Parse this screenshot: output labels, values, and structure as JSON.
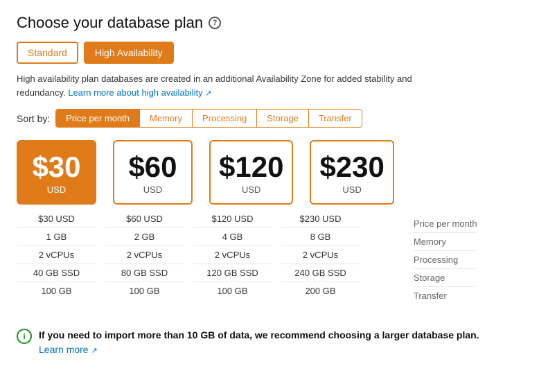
{
  "page": {
    "title": "Choose your database plan",
    "help_icon": "?",
    "description": "High availability plan databases are created in an additional Availability Zone for added stability and redundancy.",
    "learn_more_link": "Learn more about high availability",
    "sort_label": "Sort by:"
  },
  "plan_toggle": {
    "standard_label": "Standard",
    "high_availability_label": "High Availability"
  },
  "sort_tabs": [
    {
      "id": "price",
      "label": "Price per month",
      "active": true
    },
    {
      "id": "memory",
      "label": "Memory",
      "active": false
    },
    {
      "id": "processing",
      "label": "Processing",
      "active": false
    },
    {
      "id": "storage",
      "label": "Storage",
      "active": false
    },
    {
      "id": "transfer",
      "label": "Transfer",
      "active": false
    }
  ],
  "plans": [
    {
      "price": "$30",
      "currency": "USD",
      "selected": true,
      "details": {
        "price_per_month": "$30 USD",
        "memory": "1 GB",
        "processing": "2 vCPUs",
        "storage": "40 GB SSD",
        "transfer": "100 GB"
      }
    },
    {
      "price": "$60",
      "currency": "USD",
      "selected": false,
      "details": {
        "price_per_month": "$60 USD",
        "memory": "2 GB",
        "processing": "2 vCPUs",
        "storage": "80 GB SSD",
        "transfer": "100 GB"
      }
    },
    {
      "price": "$120",
      "currency": "USD",
      "selected": false,
      "details": {
        "price_per_month": "$120 USD",
        "memory": "4 GB",
        "processing": "2 vCPUs",
        "storage": "120 GB SSD",
        "transfer": "100 GB"
      }
    },
    {
      "price": "$230",
      "currency": "USD",
      "selected": false,
      "details": {
        "price_per_month": "$230 USD",
        "memory": "8 GB",
        "processing": "2 vCPUs",
        "storage": "240 GB SSD",
        "transfer": "200 GB"
      }
    }
  ],
  "detail_labels": {
    "price_per_month": "Price per month",
    "memory": "Memory",
    "processing": "Processing",
    "storage": "Storage",
    "transfer": "Transfer"
  },
  "info_banner": {
    "icon": "i",
    "text_bold": "If you need to import more than 10 GB of data, we recommend choosing a larger database plan.",
    "learn_more": "Learn more"
  },
  "colors": {
    "accent": "#e07b1a",
    "link": "#0073bb",
    "info_green": "#1c8f1c"
  }
}
